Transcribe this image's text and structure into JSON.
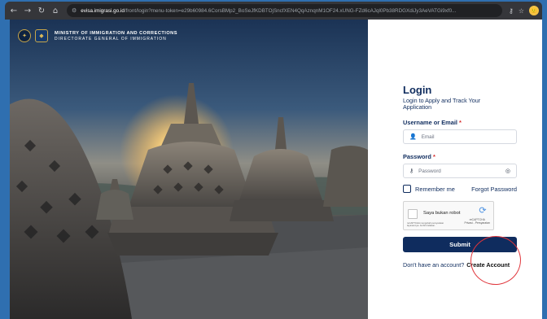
{
  "browser": {
    "icons": [
      "back-icon",
      "forward-icon",
      "reload-icon",
      "home-icon",
      "site-info-icon",
      "key-icon",
      "star-icon",
      "extension-icon"
    ],
    "url_domain": "evisa.imigrasi.go.id",
    "url_path": "/front/login?menu-token=e29b60984.6CorsBMp2_BoSeJfKDBTOjSncfXEN4QqAznqnM1OF24.xUNG-FZd6cAJql0Pb38RDGXdiJy3AeVATGi9xf0...",
    "avatar_label": "🙂"
  },
  "brand": {
    "line1": "MINISTRY OF IMMIGRATION AND CORRECTIONS",
    "line2": "DIRECTORATE GENERAL OF IMMIGRATION"
  },
  "login": {
    "title": "Login",
    "subtitle": "Login to Apply and Track Your Application",
    "username_label": "Username or Email",
    "required_mark": "*",
    "email_placeholder": "Email",
    "password_label": "Password",
    "password_placeholder": "Password",
    "remember_label": "Remember me",
    "forgot_label": "Forgot Password",
    "submit_label": "Submit",
    "no_account_text": "Don't have an account?",
    "create_account_label": "Create Account"
  },
  "recaptcha": {
    "label": "Saya bukan robot",
    "note": "reCAPTCHA mengubah persyaratan layanannya. Ambil tindakan.",
    "brand": "reCAPTCHA",
    "links": "Privasi - Persyaratan"
  },
  "colors": {
    "primary": "#0f2c5e",
    "required": "#d62b2b",
    "annotation": "#e0353b",
    "background": "#2f6fb0"
  }
}
